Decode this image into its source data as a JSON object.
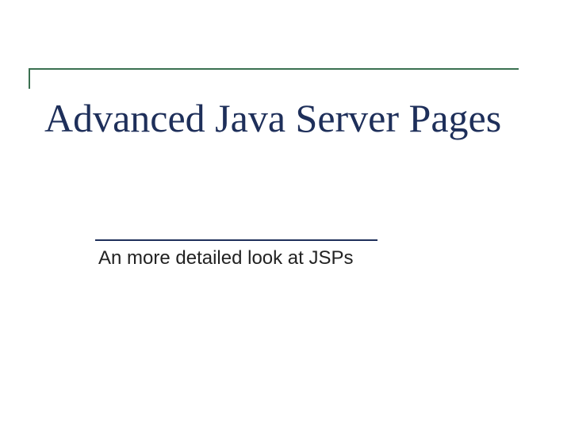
{
  "title": "Advanced Java Server Pages",
  "subtitle": "An more detailed look at JSPs"
}
